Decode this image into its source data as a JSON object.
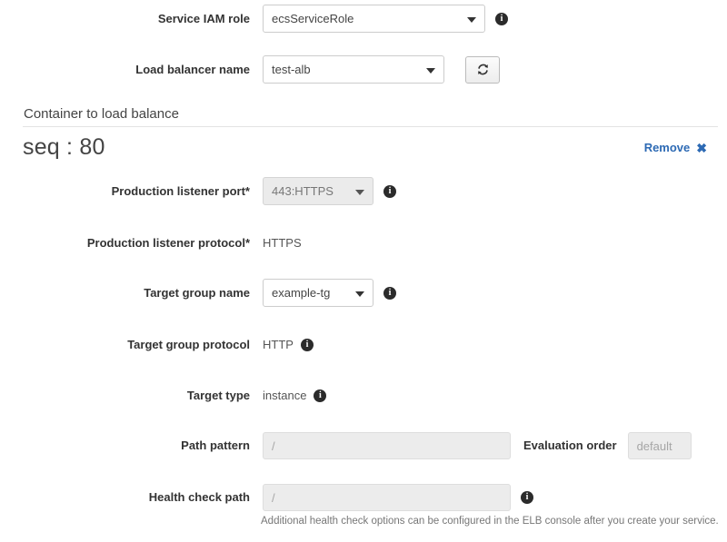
{
  "form": {
    "service_iam_role": {
      "label": "Service IAM role",
      "value": "ecsServiceRole",
      "info_icon": "info-icon"
    },
    "load_balancer_name": {
      "label": "Load balancer name",
      "value": "test-alb",
      "refresh_icon": "refresh-icon"
    }
  },
  "section": {
    "title": "Container to load balance",
    "entry_title": "seq : 80",
    "remove_label": "Remove",
    "remove_icon": "close-x-icon"
  },
  "container": {
    "production_listener_port": {
      "label": "Production listener port*",
      "value": "443:HTTPS",
      "info_icon": "info-icon"
    },
    "production_listener_protocol": {
      "label": "Production listener protocol*",
      "value": "HTTPS"
    },
    "target_group_name": {
      "label": "Target group name",
      "value": "example-tg",
      "info_icon": "info-icon"
    },
    "target_group_protocol": {
      "label": "Target group protocol",
      "value": "HTTP",
      "info_icon": "info-icon"
    },
    "target_type": {
      "label": "Target type",
      "value": "instance",
      "info_icon": "info-icon"
    },
    "path_pattern": {
      "label": "Path pattern",
      "value": "",
      "placeholder": "/"
    },
    "evaluation_order": {
      "label": "Evaluation order",
      "value": "",
      "placeholder": "default"
    },
    "health_check_path": {
      "label": "Health check path",
      "value": "",
      "placeholder": "/",
      "info_icon": "info-icon",
      "helper_text": "Additional health check options can be configured in the ELB console after you create your service."
    }
  },
  "colors": {
    "link": "#2d6ab4",
    "label": "#333333",
    "value": "#555555",
    "disabled_bg": "#ebebeb"
  }
}
